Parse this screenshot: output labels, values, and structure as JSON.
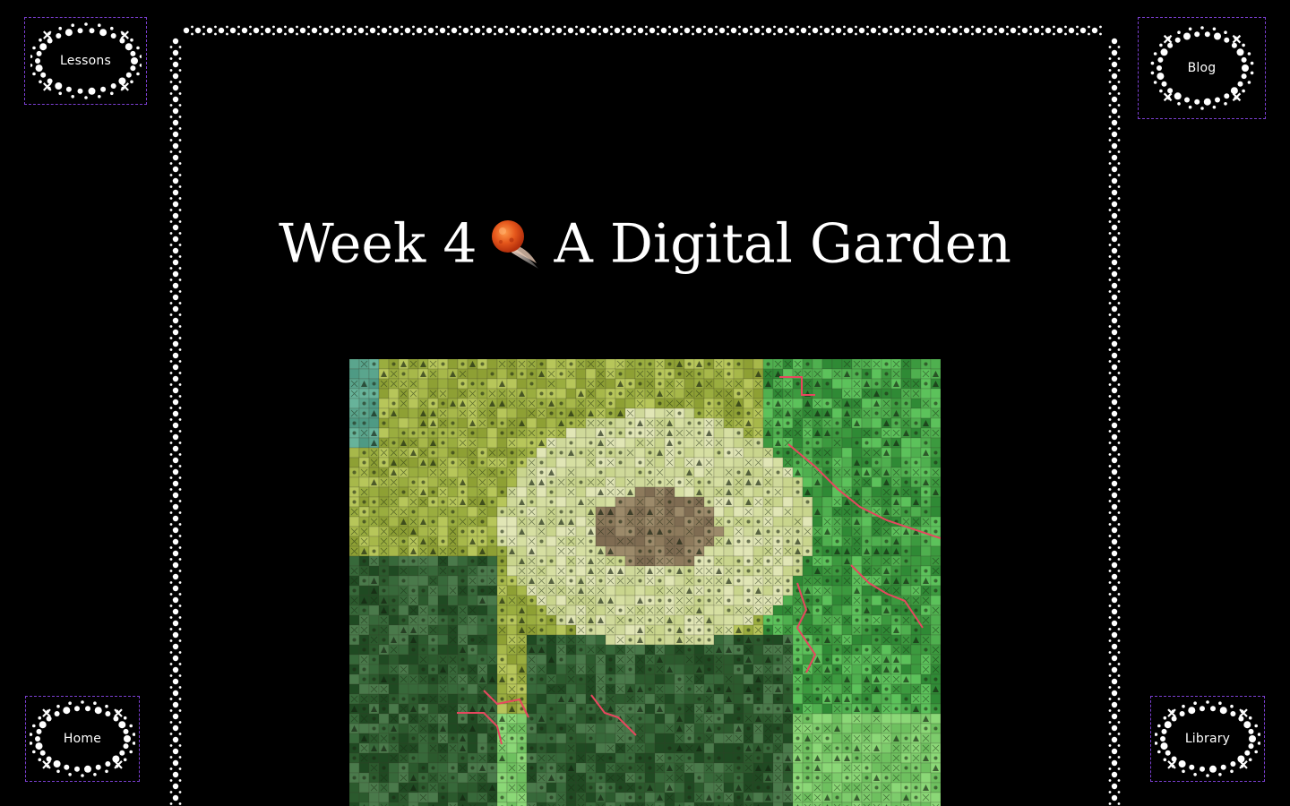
{
  "nav": {
    "lessons": "Lessons",
    "blog": "Blog",
    "home": "Home",
    "library": "Library"
  },
  "title": {
    "before": "Week 4",
    "after": "A Digital Garden"
  },
  "icons": {
    "title_icon": "comet-icon",
    "nav_decoration": "beaded-wreath-icon",
    "frame_decoration": "beaded-border"
  },
  "colors": {
    "background": "#000000",
    "nav_border": "#7b3fd1",
    "text": "#ffffff",
    "comet": "#e4561b"
  },
  "image": {
    "subject": "cross-stitch-pattern"
  }
}
